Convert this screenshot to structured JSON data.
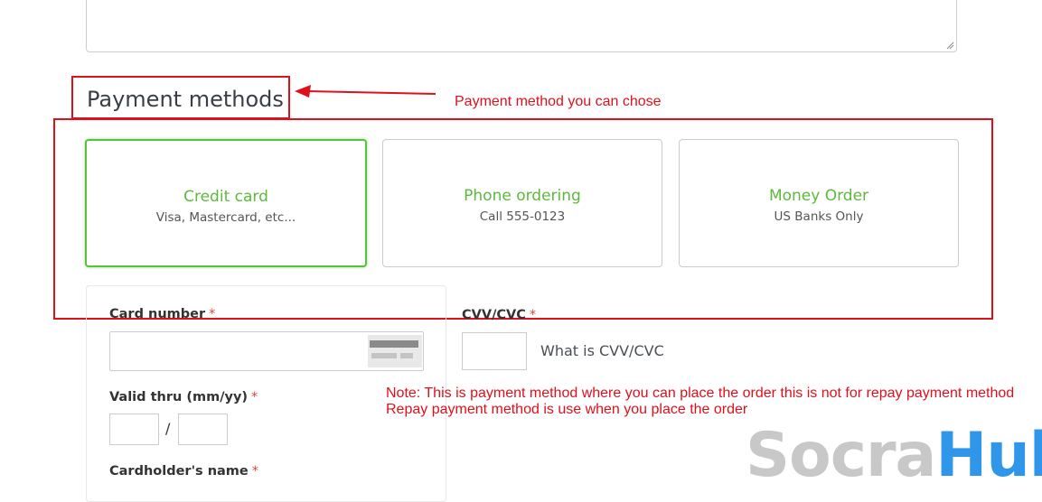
{
  "section": {
    "title": "Payment methods"
  },
  "annotations": {
    "title_note": "Payment method you can chose",
    "note_line1": "Note: This is payment method where you can place the order this is not for repay payment method",
    "note_line2": "Repay payment method is use when you place the order"
  },
  "methods": [
    {
      "name": "Credit card",
      "sub": "Visa, Mastercard, etc...",
      "selected": true
    },
    {
      "name": "Phone ordering",
      "sub": "Call 555-0123",
      "selected": false
    },
    {
      "name": "Money Order",
      "sub": "US Banks Only",
      "selected": false
    }
  ],
  "form": {
    "card_number_label": "Card number",
    "cvv_label": "CVV/CVC",
    "cvv_help": "What is CVV/CVC",
    "valid_thru_label": "Valid thru (mm/yy)",
    "slash": "/",
    "cardholder_label": "Cardholder's name",
    "required_mark": "*"
  },
  "watermark": {
    "part1": "Socra",
    "part2": "Hub"
  },
  "colors": {
    "accent_green": "#5cba3b",
    "annotation_red": "#e0101b",
    "watermark_blue": "#2f96ea",
    "watermark_gray": "#c8c8c8"
  }
}
